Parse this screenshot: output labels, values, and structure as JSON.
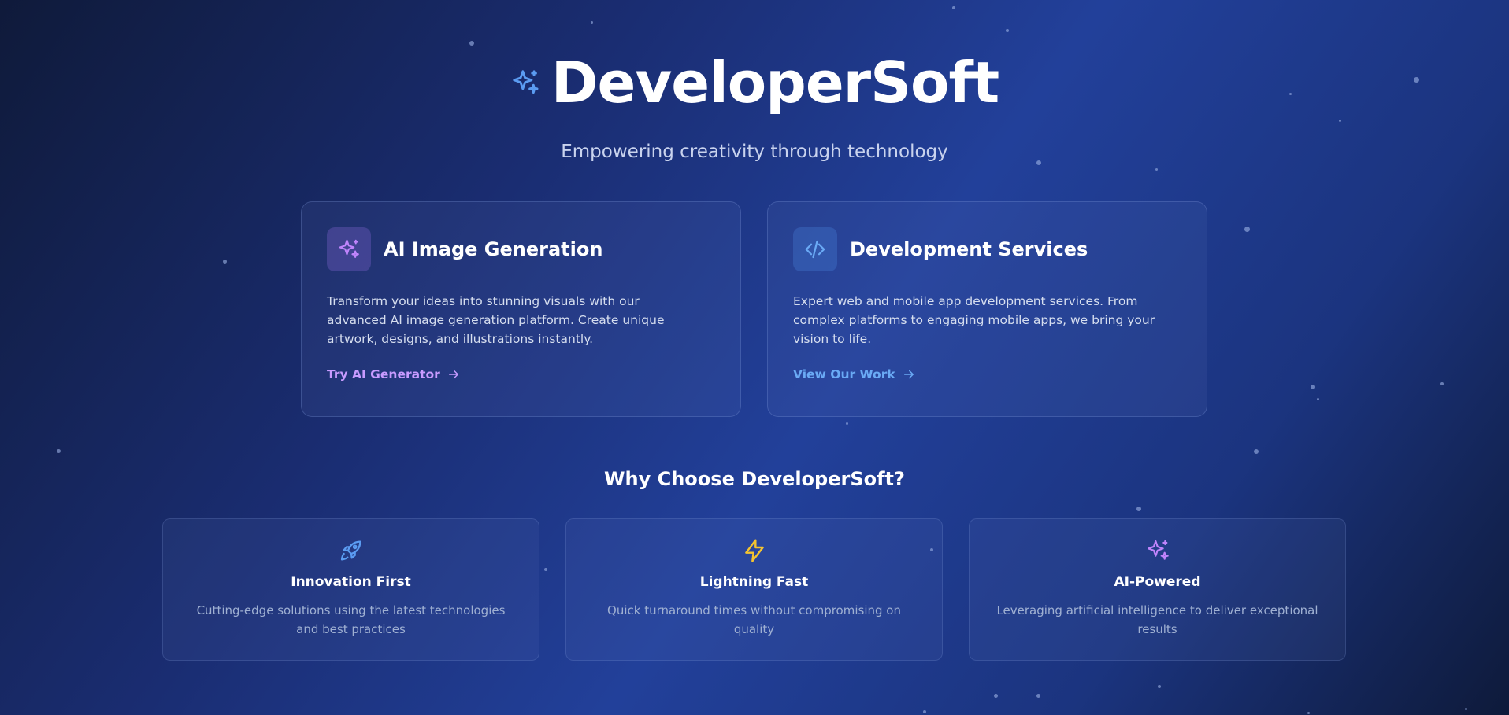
{
  "hero": {
    "brand": "DeveloperSoft",
    "tagline": "Empowering creativity through technology",
    "brand_icon": "sparkles-icon"
  },
  "services": [
    {
      "title": "AI Image Generation",
      "icon": "sparkles-icon",
      "description": "Transform your ideas into stunning visuals with our advanced AI image generation platform. Create unique artwork, designs, and illustrations instantly.",
      "link_label": "Try AI Generator",
      "accent": "#c89bff"
    },
    {
      "title": "Development Services",
      "icon": "code-icon",
      "description": "Expert web and mobile app development services. From complex platforms to engaging mobile apps, we bring your vision to life.",
      "link_label": "View Our Work",
      "accent": "#6aaaf5"
    }
  ],
  "why": {
    "title": "Why Choose DeveloperSoft?",
    "features": [
      {
        "title": "Innovation First",
        "description": "Cutting-edge solutions using the latest technologies and best practices",
        "icon": "rocket-icon",
        "color": "#5b9cf2"
      },
      {
        "title": "Lightning Fast",
        "description": "Quick turnaround times without compromising on quality",
        "icon": "lightning-icon",
        "color": "#f4c430"
      },
      {
        "title": "AI-Powered",
        "description": "Leveraging artificial intelligence to deliver exceptional results",
        "icon": "sparkles-icon",
        "color": "#c084fc"
      }
    ]
  }
}
